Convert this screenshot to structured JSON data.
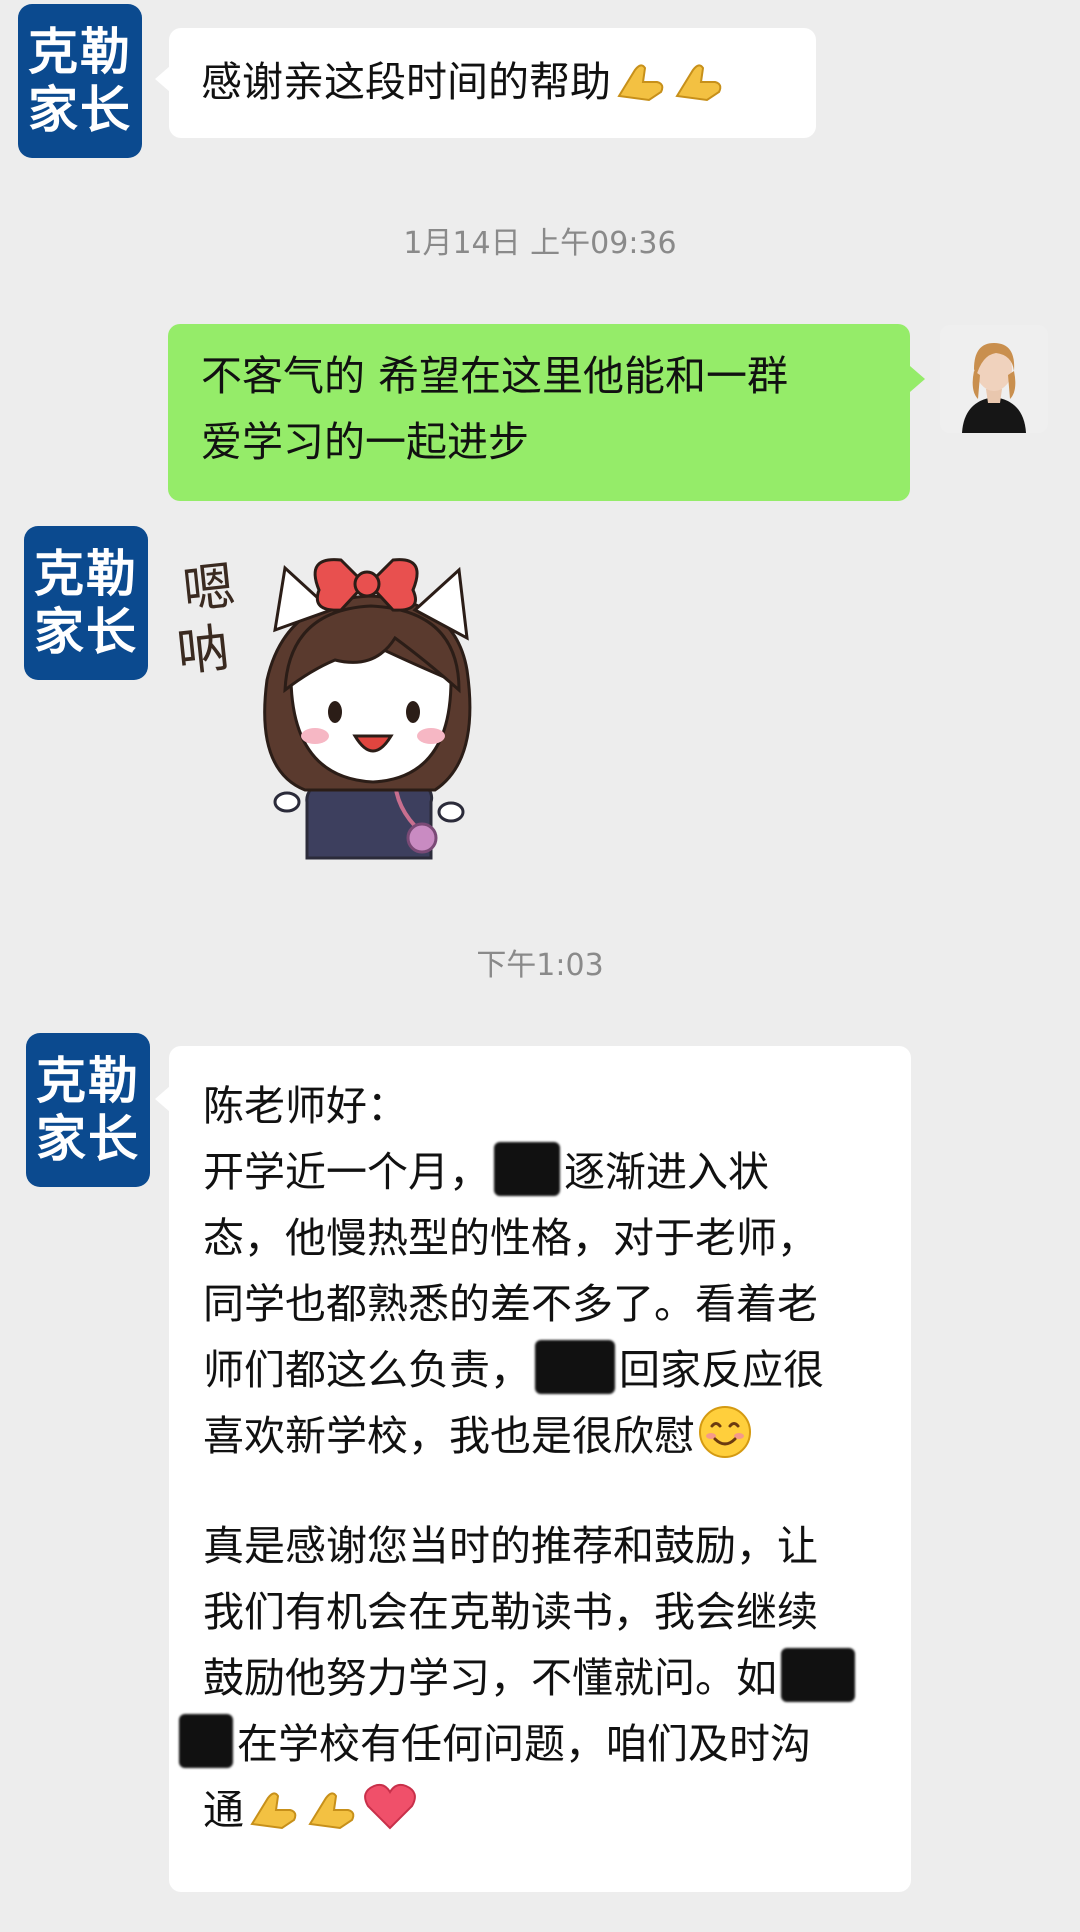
{
  "brand_avatar": {
    "line1": "克勒",
    "line2": "家长"
  },
  "messages": {
    "m1": {
      "text": "感谢亲这段时间的帮助"
    },
    "t1": "1月14日 上午09:36",
    "m2": {
      "line1": "不客气的 希望在这里他能和一群",
      "line2": "爱学习的一起进步"
    },
    "sticker": {
      "caption_line1": "嗯",
      "caption_line2": "呐",
      "icon": "girl-bow-sticker"
    },
    "t2": "下午1:03",
    "m3": {
      "l1": "陈老师好：",
      "l2a": "开学近一个月，",
      "l2b": "逐渐进入状",
      "l3": "态，他慢热型的性格，对于老师，",
      "l4": "同学也都熟悉的差不多了。看着老",
      "l5a": "师们都这么负责，",
      "l5b": "回家反应很",
      "l6": "喜欢新学校，我也是很欣慰",
      "l7": "真是感谢您当时的推荐和鼓励，让",
      "l8": "我们有机会在克勒读书，我会继续",
      "l9": "鼓励他努力学习，不懂就问。如",
      "l10": "在学校有任何问题，咱们及时沟",
      "l11": "通"
    }
  },
  "colors": {
    "background": "#ededed",
    "brand_blue": "#0b4a8f",
    "green_bubble": "#95ec69",
    "white_bubble": "#ffffff"
  }
}
